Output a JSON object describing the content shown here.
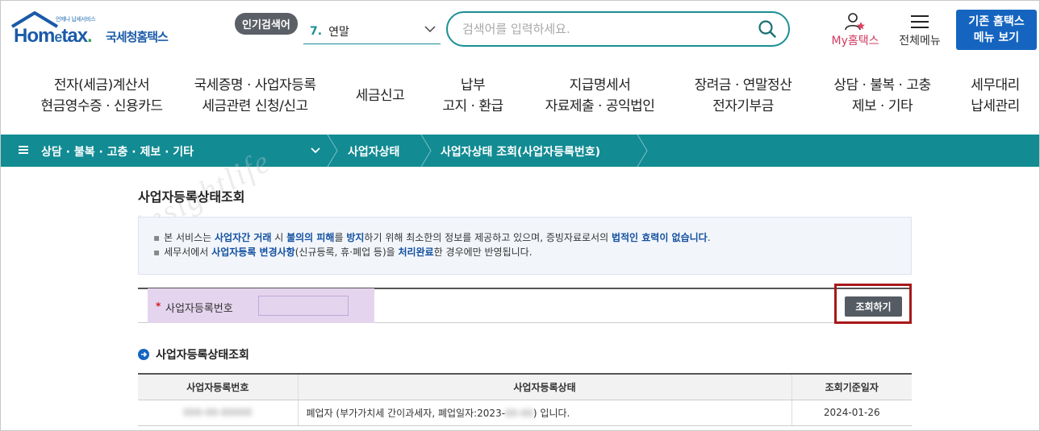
{
  "header": {
    "logo_tagline": "언제나 납세서비스",
    "logo_brand_1": "Hom",
    "logo_brand_e": "e",
    "logo_brand_2": "tax",
    "logo_brand_dot": ".",
    "logo_kr": "국세청홈택스",
    "popular_badge": "인기검색어",
    "popular_rank": "7.",
    "popular_word": "연말",
    "search_placeholder": "검색어를 입력하세요.",
    "my_hometax": "My홈택스",
    "all_menu": "전체메뉴",
    "old_home_line1": "기존 홈택스",
    "old_home_line2": "메뉴 보기"
  },
  "gnb": [
    {
      "line1": "전자(세금)계산서",
      "line2": "현금영수증 · 신용카드"
    },
    {
      "line1": "국세증명 · 사업자등록",
      "line2": "세금관련 신청/신고"
    },
    {
      "line1": "세금신고",
      "line2": ""
    },
    {
      "line1": "납부",
      "line2": "고지 · 환급"
    },
    {
      "line1": "지급명세서",
      "line2": "자료제출 · 공익법인"
    },
    {
      "line1": "장려금 · 연말정산",
      "line2": "전자기부금"
    },
    {
      "line1": "상담 · 불복 · 고충",
      "line2": "제보 · 기타"
    },
    {
      "line1": "세무대리",
      "line2": "납세관리"
    }
  ],
  "breadcrumb": {
    "menu": "상담 · 불복 · 고충 · 제보 · 기타",
    "level2": "사업자상태",
    "level3": "사업자상태 조회(사업자등록번호)"
  },
  "watermark": "insightlife",
  "page_title": "사업자등록상태조회",
  "notice": {
    "line1": [
      "본 서비스는 ",
      "사업자간 거래",
      " 시 ",
      "불의의 피해",
      "를 ",
      "방지",
      "하기 위해 최소한의 정보를 제공하고 있으며, 증빙자료로서의 ",
      "법적인 효력이 없습니다",
      "."
    ],
    "line2": [
      "세무서에서 ",
      "사업자등록 변경사항",
      "(신규등록, 휴·폐업 등)을 ",
      "처리완료",
      "한 경우에만 반영됩니다."
    ]
  },
  "form": {
    "required_mark": "*",
    "label": "사업자등록번호",
    "input_value": "",
    "query_button": "조회하기"
  },
  "result_section_title": "사업자등록상태조회",
  "result_table": {
    "headers": [
      "사업자등록번호",
      "사업자등록상태",
      "조회기준일자"
    ],
    "rows": [
      {
        "biz_no": "000-00-00000",
        "status_prefix": "폐업자 (부가가치세 간이과세자, 폐업일자:2023-",
        "status_hidden": "00-00",
        "status_suffix": ") 입니다.",
        "date": "2024-01-26"
      }
    ]
  },
  "colors": {
    "teal": "#128b93",
    "blue": "#1565c0",
    "highlight_purple": "#e5d4ee",
    "red_outline": "#a81818"
  }
}
